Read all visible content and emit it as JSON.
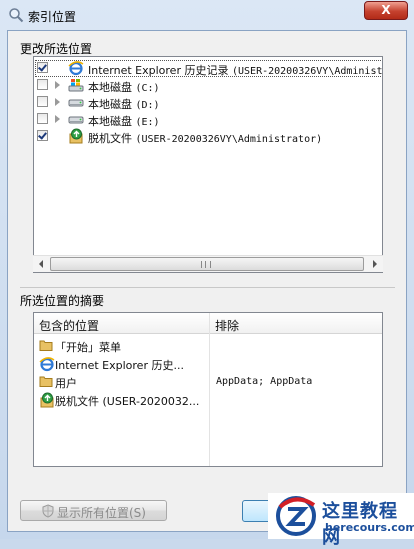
{
  "window": {
    "title": "索引位置",
    "close_label": "X"
  },
  "change_section": {
    "label": "更改所选位置"
  },
  "tree_items": [
    {
      "checked": true,
      "expandable": false,
      "icon": "internet-explorer-icon",
      "name": "Internet Explorer 历史记录",
      "detail": "(USER-20200326VY\\Administrator)"
    },
    {
      "checked": false,
      "expandable": true,
      "icon": "system-drive-icon",
      "name": "本地磁盘",
      "detail": "(C:)"
    },
    {
      "checked": false,
      "expandable": true,
      "icon": "local-drive-icon",
      "name": "本地磁盘",
      "detail": "(D:)"
    },
    {
      "checked": false,
      "expandable": true,
      "icon": "local-drive-icon",
      "name": "本地磁盘",
      "detail": "(E:)"
    },
    {
      "checked": true,
      "expandable": false,
      "icon": "offline-files-icon",
      "name": "脱机文件",
      "detail": "(USER-20200326VY\\Administrator)"
    }
  ],
  "summary_section": {
    "label": "所选位置的摘要",
    "col_included": "包含的位置",
    "col_excluded": "排除",
    "rows": [
      {
        "icon": "folder-icon",
        "location": "「开始」菜单",
        "exclude": ""
      },
      {
        "icon": "internet-explorer-icon",
        "location": "Internet Explorer 历史...",
        "exclude": ""
      },
      {
        "icon": "folder-icon",
        "location": "用户",
        "exclude": "AppData; AppData"
      },
      {
        "icon": "offline-files-icon",
        "location": "脱机文件 (USER-2020032...",
        "exclude": ""
      }
    ]
  },
  "buttons": {
    "show_all": "显示所有位置(S)"
  },
  "watermark": {
    "line1": "这里教程网",
    "line2": "herecours.com"
  },
  "colors": {
    "checkbox_mark": "#1d3a7a",
    "watermark_red": "#d21f26",
    "watermark_blue": "#1c4f9c"
  }
}
